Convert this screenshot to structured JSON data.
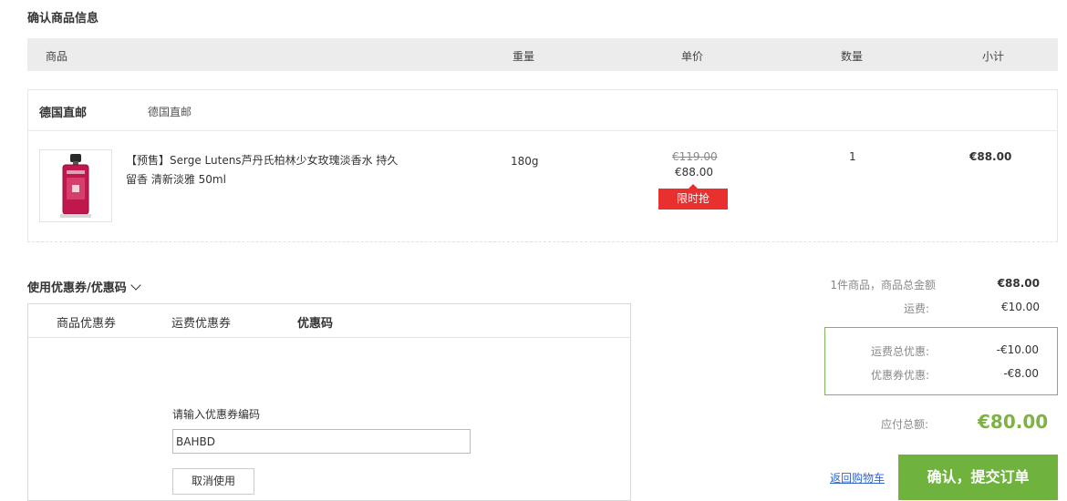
{
  "page_title": "确认商品信息",
  "table_header": {
    "product": "商品",
    "weight": "重量",
    "unit_price": "单价",
    "quantity": "数量",
    "subtotal": "小计"
  },
  "shop": {
    "name": "德国直邮",
    "subtitle": "德国直邮"
  },
  "item": {
    "title": "【预售】Serge Lutens芦丹氏柏林少女玫瑰淡香水 持久留香 清新淡雅 50ml",
    "weight": "180g",
    "original_price": "€119.00",
    "price": "€88.00",
    "badge": "限时抢",
    "quantity": "1",
    "subtotal": "€88.00"
  },
  "coupon": {
    "title": "使用优惠券/优惠码",
    "tabs": [
      "商品优惠券",
      "运费优惠券",
      "优惠码"
    ],
    "active_tab": "优惠码",
    "input_label": "请输入优惠券编码",
    "input_value": "BAHBD",
    "cancel_label": "取消使用"
  },
  "summary": {
    "goods_label": "1件商品，商品总金额",
    "goods_value": "€88.00",
    "shipping_label": "运费:",
    "shipping_value": "€10.00",
    "shipping_discount_label": "运费总优惠:",
    "shipping_discount_value": "-€10.00",
    "coupon_discount_label": "优惠券优惠:",
    "coupon_discount_value": "-€8.00",
    "total_label": "应付总额:",
    "total_value": "€80.00"
  },
  "actions": {
    "back_to_cart": "返回购物车",
    "submit": "确认，提交订单"
  },
  "colors": {
    "accent_green": "#6fb23d",
    "badge_red": "#e8312f"
  }
}
